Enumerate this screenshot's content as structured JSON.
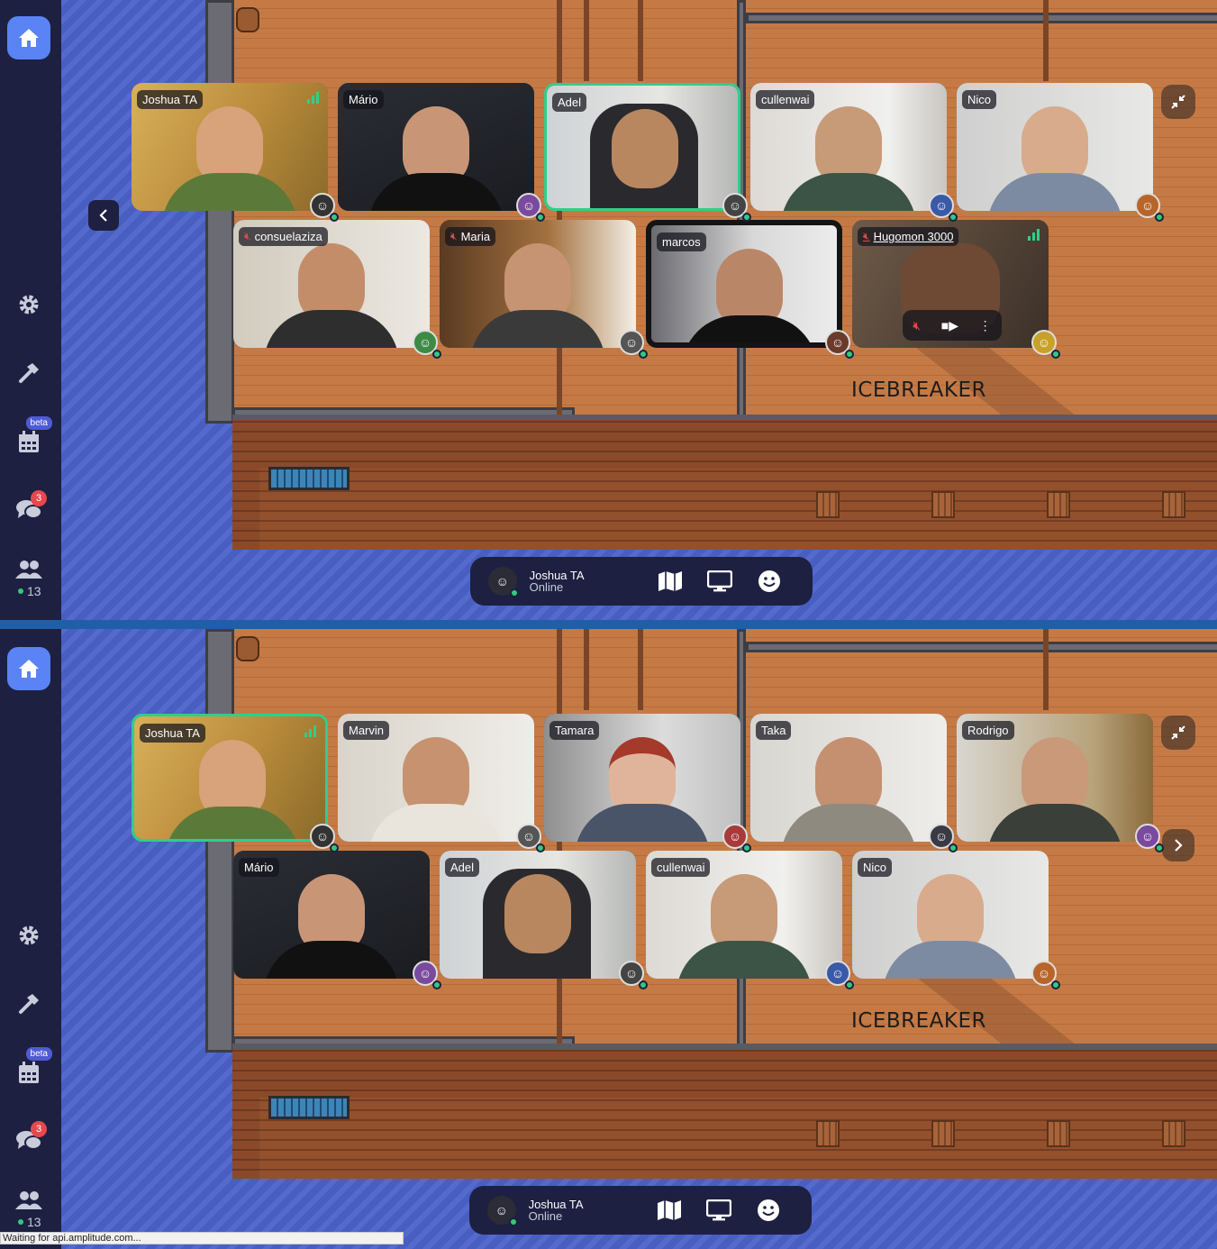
{
  "sidebar": {
    "beta_label": "beta",
    "chat_badge": "3",
    "online_count": "13"
  },
  "room_label": "ICEBREAKER",
  "bottom_bar": {
    "user_name": "Joshua TA",
    "user_status": "Online"
  },
  "colors": {
    "accent": "#5a83f5",
    "active_border": "#2ecf8a",
    "muted": "#e5484d",
    "sidebar_bg": "#1d2040",
    "water": "#4b62c9",
    "deck": "#c57a45"
  },
  "top": {
    "row1": [
      {
        "name": "Joshua TA",
        "muted": false,
        "signal": true
      },
      {
        "name": "Mário",
        "muted": false
      },
      {
        "name": "Adel",
        "muted": false,
        "active": true
      },
      {
        "name": "cullenwai",
        "muted": false
      },
      {
        "name": "Nico",
        "muted": false
      }
    ],
    "row2": [
      {
        "name": "consuelaziza",
        "muted": true
      },
      {
        "name": "Maria",
        "muted": true
      },
      {
        "name": "marcos",
        "muted": false
      },
      {
        "name": "Hugomon 3000",
        "muted": true,
        "signal": true
      }
    ]
  },
  "bottom": {
    "row1": [
      {
        "name": "Joshua TA",
        "muted": false,
        "signal": true,
        "active": true
      },
      {
        "name": "Marvin",
        "muted": false
      },
      {
        "name": "Tamara",
        "muted": false
      },
      {
        "name": "Taka",
        "muted": false
      },
      {
        "name": "Rodrigo",
        "muted": false
      }
    ],
    "row2": [
      {
        "name": "Mário",
        "muted": false
      },
      {
        "name": "Adel",
        "muted": false
      },
      {
        "name": "cullenwai",
        "muted": false
      },
      {
        "name": "Nico",
        "muted": false
      }
    ]
  },
  "icons": {
    "home": "home-icon",
    "settings": "gear-icon",
    "build": "hammer-icon",
    "calendar": "calendar-icon",
    "chat": "chat-icon",
    "people": "people-icon",
    "map": "map-icon",
    "screen": "screen-share-icon",
    "emoji": "emoji-icon",
    "minimize": "minimize-icon",
    "prev": "chevron-left-icon",
    "next": "chevron-right-icon"
  },
  "browser_status": "Waiting for api.amplitude.com..."
}
